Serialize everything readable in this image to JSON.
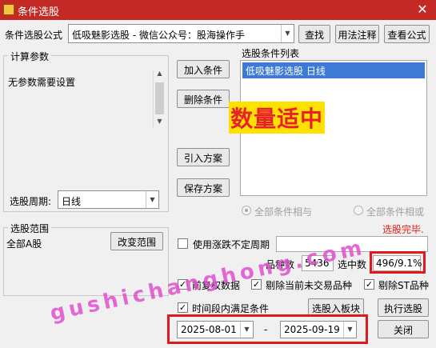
{
  "window": {
    "title": "条件选股",
    "close_glyph": "✕"
  },
  "formula": {
    "label": "条件选股公式",
    "selected": "低吸魅影选股 - 微信公众号：股海操作手",
    "find_button": "查找",
    "usage_button": "用法注释",
    "view_button": "查看公式"
  },
  "params": {
    "group_title": "计算参数",
    "text": "无参数需要设置"
  },
  "period": {
    "label": "选股周期:",
    "value": "日线"
  },
  "buttons": {
    "add_condition": "加入条件",
    "delete_condition": "删除条件",
    "import_scheme": "引入方案",
    "save_scheme": "保存方案",
    "change_range": "改变范围",
    "select_to_block": "选股入板块",
    "execute": "执行选股",
    "close": "关闭"
  },
  "conditions": {
    "list_title": "选股条件列表",
    "items": [
      "低吸魅影选股  日线"
    ],
    "overlay_label": "数量适中"
  },
  "logic": {
    "and_label": "全部条件相与",
    "or_label": "全部条件相或"
  },
  "status": {
    "text": "选股完毕."
  },
  "range": {
    "group_title": "选股范围",
    "value": "全部A股"
  },
  "options": {
    "use_zdt_period": "使用涨跌不定周期",
    "adjusted_data": "前复权数据",
    "exclude_non_trading": "剔除当前未交易品种",
    "exclude_st": "剔除ST品种",
    "time_period_condition": "时间段内满足条件"
  },
  "counts": {
    "kinds_label": "品种数",
    "kinds_value": "5436",
    "selected_label": "选中数",
    "selected_value": "496/9.1%"
  },
  "dates": {
    "start": "2025-08-01",
    "separator": "-",
    "end": "2025-09-19"
  },
  "watermark": {
    "text": "gushichanghong.com"
  },
  "colors": {
    "titlebar": "#c42a25",
    "highlight_box": "#e0191e",
    "selection": "#3c7ad6",
    "overlay_text": "#e8202a",
    "overlay_bg": "#ffe100",
    "watermark": "#e04fd0"
  }
}
